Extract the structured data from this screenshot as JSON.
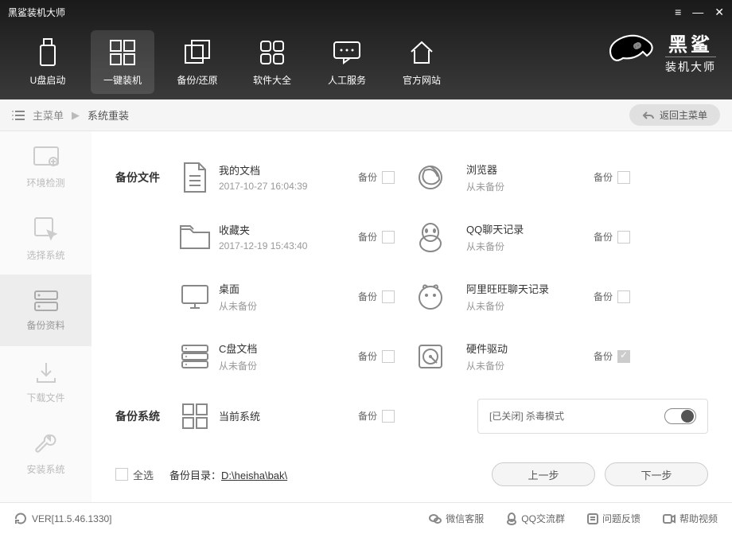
{
  "window": {
    "title": "黑鲨装机大师"
  },
  "nav": {
    "items": [
      {
        "label": "U盘启动"
      },
      {
        "label": "一键装机"
      },
      {
        "label": "备份/还原"
      },
      {
        "label": "软件大全"
      },
      {
        "label": "人工服务"
      },
      {
        "label": "官方网站"
      }
    ],
    "active_index": 1
  },
  "logo": {
    "line1": "黑鲨",
    "line2": "装机大师"
  },
  "breadcrumb": {
    "root": "主菜单",
    "current": "系统重装",
    "back": "返回主菜单"
  },
  "sidebar": {
    "items": [
      {
        "label": "环境检测"
      },
      {
        "label": "选择系统"
      },
      {
        "label": "备份资料"
      },
      {
        "label": "下载文件"
      },
      {
        "label": "安装系统"
      }
    ],
    "active_index": 2
  },
  "sections": {
    "backup_files_label": "备份文件",
    "backup_system_label": "备份系统",
    "backup_action": "备份",
    "never_backed": "从未备份"
  },
  "rows": [
    {
      "left": {
        "name": "我的文档",
        "sub": "2017-10-27 16:04:39",
        "checked": false
      },
      "right": {
        "name": "浏览器",
        "sub": "从未备份",
        "checked": false
      }
    },
    {
      "left": {
        "name": "收藏夹",
        "sub": "2017-12-19 15:43:40",
        "checked": false
      },
      "right": {
        "name": "QQ聊天记录",
        "sub": "从未备份",
        "checked": false
      }
    },
    {
      "left": {
        "name": "桌面",
        "sub": "从未备份",
        "checked": false
      },
      "right": {
        "name": "阿里旺旺聊天记录",
        "sub": "从未备份",
        "checked": false
      }
    },
    {
      "left": {
        "name": "C盘文档",
        "sub": "从未备份",
        "checked": false
      },
      "right": {
        "name": "硬件驱动",
        "sub": "从未备份",
        "checked": true
      }
    }
  ],
  "system_row": {
    "name": "当前系统",
    "sub": "",
    "checked": false
  },
  "virus": {
    "status": "[已关闭]",
    "label": "杀毒模式"
  },
  "bottom": {
    "select_all": "全选",
    "path_label": "备份目录：",
    "path_value": "D:\\heisha\\bak\\",
    "prev": "上一步",
    "next": "下一步"
  },
  "footer": {
    "version": "VER[11.5.46.1330]",
    "links": [
      {
        "label": "微信客服"
      },
      {
        "label": "QQ交流群"
      },
      {
        "label": "问题反馈"
      },
      {
        "label": "帮助视频"
      }
    ]
  }
}
